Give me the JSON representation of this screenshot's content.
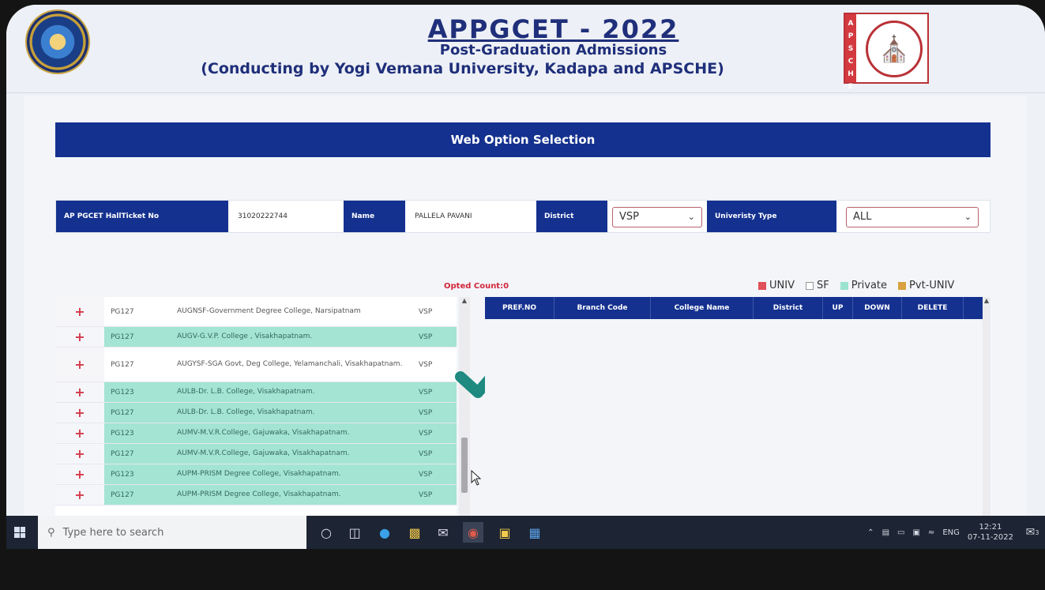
{
  "header": {
    "title": "APPGCET - 2022",
    "subtitle": "Post-Graduation Admissions",
    "conducting": "(Conducting by Yogi Vemana University, Kadapa and APSCHE)",
    "right_logo_letters": "APSCHE"
  },
  "banner": {
    "title": "Web Option Selection"
  },
  "form": {
    "hallticket_label": "AP PGCET HallTicket No",
    "hallticket_value": "31020222744",
    "name_label": "Name",
    "name_value": "PALLELA PAVANI",
    "district_label": "District",
    "district_value": "VSP",
    "univ_type_label": "Univeristy Type",
    "univ_type_value": "ALL"
  },
  "opted_count": "Opted Count:0",
  "legend": [
    {
      "label": "UNIV",
      "color": "#e0505a"
    },
    {
      "label": "SF",
      "color": "#ffffff"
    },
    {
      "label": "Private",
      "color": "#9be3cc"
    },
    {
      "label": "Pvt-UNIV",
      "color": "#d9a23e"
    }
  ],
  "college_list": [
    {
      "code": "PG127",
      "name": "AUGNSF-Government Degree College, Narsipatnam",
      "district": "VSP",
      "highlight": false
    },
    {
      "code": "PG127",
      "name": "AUGV-G.V.P. College , Visakhapatnam.",
      "district": "VSP",
      "highlight": true
    },
    {
      "code": "PG127",
      "name": "AUGYSF-SGA Govt, Deg College, Yelamanchali, Visakhapatnam.",
      "district": "VSP",
      "highlight": false
    },
    {
      "code": "PG123",
      "name": "AULB-Dr. L.B. College, Visakhapatnam.",
      "district": "VSP",
      "highlight": true
    },
    {
      "code": "PG127",
      "name": "AULB-Dr. L.B. College, Visakhapatnam.",
      "district": "VSP",
      "highlight": true
    },
    {
      "code": "PG123",
      "name": "AUMV-M.V.R.College, Gajuwaka, Visakhapatnam.",
      "district": "VSP",
      "highlight": true
    },
    {
      "code": "PG127",
      "name": "AUMV-M.V.R.College, Gajuwaka, Visakhapatnam.",
      "district": "VSP",
      "highlight": true
    },
    {
      "code": "PG123",
      "name": "AUPM-PRISM Degree College, Visakhapatnam.",
      "district": "VSP",
      "highlight": true
    },
    {
      "code": "PG127",
      "name": "AUPM-PRISM Degree College, Visakhapatnam.",
      "district": "VSP",
      "highlight": true
    }
  ],
  "options_table": {
    "headers": [
      "PREF.NO",
      "Branch Code",
      "College Name",
      "District",
      "UP",
      "DOWN",
      "DELETE"
    ]
  },
  "taskbar": {
    "search_placeholder": "Type here to search",
    "language": "ENG",
    "time": "12:21",
    "date": "07-11-2022",
    "notifications": "3"
  }
}
